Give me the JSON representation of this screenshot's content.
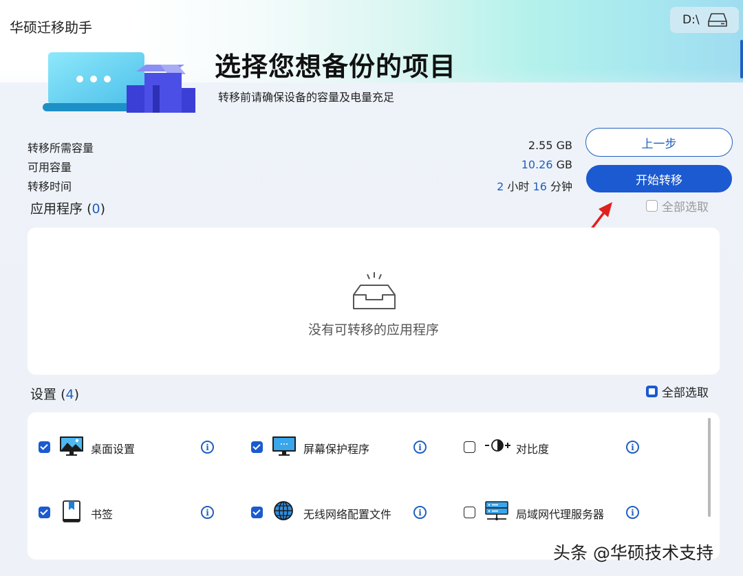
{
  "app": {
    "title": "华硕迁移助手",
    "drive": "D:\\"
  },
  "page": {
    "title": "选择您想备份的项目",
    "subtitle": "转移前请确保设备的容量及电量充足"
  },
  "stats": {
    "required": {
      "label": "转移所需容量",
      "value": "2.55",
      "unit": "GB"
    },
    "available": {
      "label": "可用容量",
      "value": "10.26",
      "unit": "GB"
    },
    "time": {
      "label": "转移时间",
      "hours": "2",
      "hours_unit": "小时",
      "minutes": "16",
      "minutes_unit": "分钟"
    }
  },
  "buttons": {
    "back": "上一步",
    "start": "开始转移"
  },
  "apps": {
    "title": "应用程序",
    "count": "0",
    "select_all": "全部选取",
    "empty_text": "没有可转移的应用程序"
  },
  "settings": {
    "title": "设置",
    "count": "4",
    "select_all": "全部选取",
    "items": [
      {
        "label": "桌面设置",
        "checked": true,
        "icon": "desktop-icon"
      },
      {
        "label": "屏幕保护程序",
        "checked": true,
        "icon": "monitor-icon"
      },
      {
        "label": "对比度",
        "checked": false,
        "icon": "contrast-icon"
      },
      {
        "label": "书签",
        "checked": true,
        "icon": "bookmark-icon"
      },
      {
        "label": "无线网络配置文件",
        "checked": true,
        "icon": "globe-icon"
      },
      {
        "label": "局域网代理服务器",
        "checked": false,
        "icon": "server-icon"
      }
    ]
  },
  "watermark": "头条 @华硕技术支持",
  "colors": {
    "accent": "#1b5ad0",
    "annotation_arrow": "#e0211d"
  }
}
